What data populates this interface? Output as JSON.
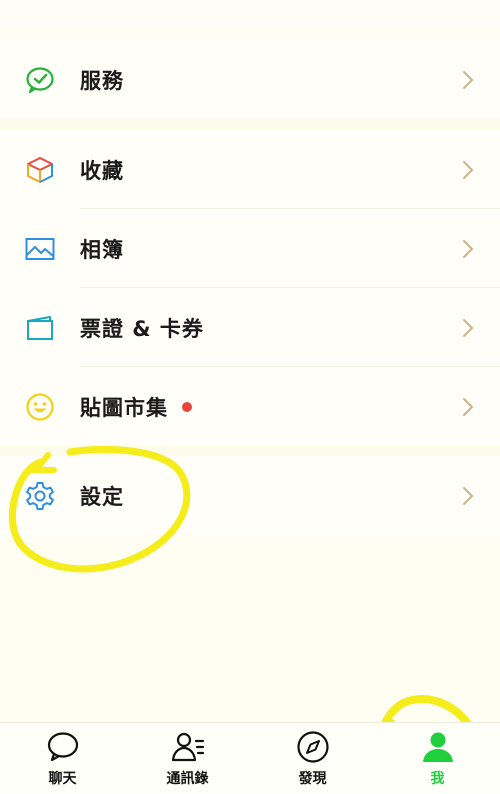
{
  "menu": {
    "service": {
      "label": "服務",
      "icon": "service-check-bubble-icon"
    },
    "favorites": {
      "label": "收藏",
      "icon": "cube-icon"
    },
    "album": {
      "label": "相簿",
      "icon": "image-icon"
    },
    "tickets": {
      "label": "票證 & 卡券",
      "icon": "card-icon"
    },
    "sticker_market": {
      "label": "貼圖市集",
      "icon": "smiley-icon",
      "badge": "new-dot"
    },
    "settings": {
      "label": "設定",
      "icon": "gear-icon"
    }
  },
  "tabbar": {
    "items": [
      {
        "label": "聊天",
        "icon": "chat-bubble-icon"
      },
      {
        "label": "通訊錄",
        "icon": "contacts-icon"
      },
      {
        "label": "發現",
        "icon": "compass-icon"
      },
      {
        "label": "我",
        "icon": "person-icon",
        "active": true
      }
    ]
  },
  "colors": {
    "accent_green": "#1fcf3b",
    "badge_red": "#e8453c",
    "highlight_yellow": "#f5ec1c",
    "chevron": "#c9b48a"
  }
}
